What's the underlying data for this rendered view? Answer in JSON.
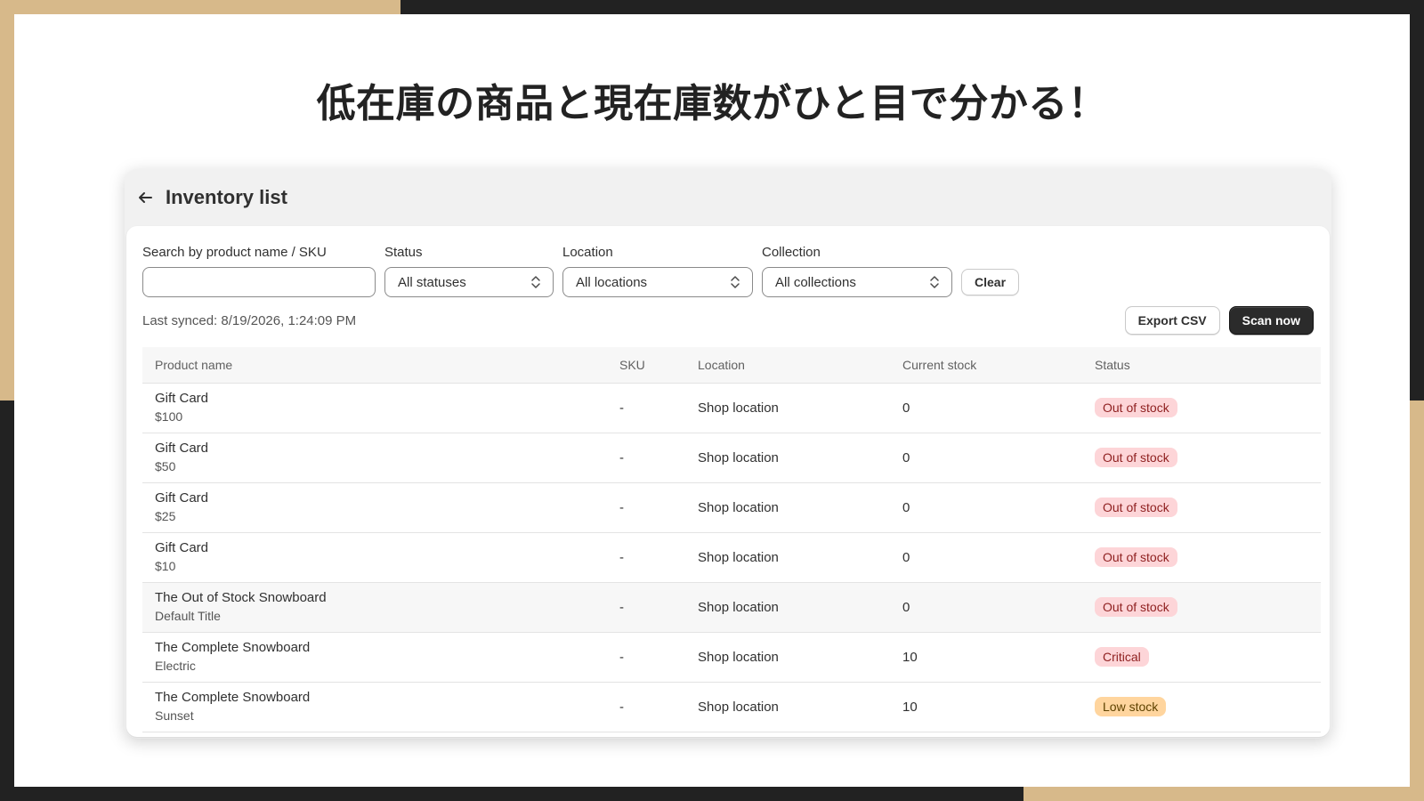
{
  "headline": "低在庫の商品と現在庫数がひと目で分かる！",
  "app": {
    "title": "Inventory list",
    "back_icon": "arrow-left-icon"
  },
  "filters": {
    "search_label": "Search by product name / SKU",
    "search_value": "",
    "status_label": "Status",
    "status_value": "All statuses",
    "location_label": "Location",
    "location_value": "All locations",
    "collection_label": "Collection",
    "collection_value": "All collections",
    "clear_label": "Clear"
  },
  "sync": {
    "text": "Last synced: 8/19/2026, 1:24:09 PM",
    "export_label": "Export CSV",
    "scan_label": "Scan now"
  },
  "table": {
    "columns": [
      "Product name",
      "SKU",
      "Location",
      "Current stock",
      "Status"
    ],
    "rows": [
      {
        "name": "Gift Card",
        "variant": "$100",
        "sku": "-",
        "location": "Shop location",
        "stock": "0",
        "status": "Out of stock"
      },
      {
        "name": "Gift Card",
        "variant": "$50",
        "sku": "-",
        "location": "Shop location",
        "stock": "0",
        "status": "Out of stock"
      },
      {
        "name": "Gift Card",
        "variant": "$25",
        "sku": "-",
        "location": "Shop location",
        "stock": "0",
        "status": "Out of stock"
      },
      {
        "name": "Gift Card",
        "variant": "$10",
        "sku": "-",
        "location": "Shop location",
        "stock": "0",
        "status": "Out of stock"
      },
      {
        "name": "The Out of Stock Snowboard",
        "variant": "Default Title",
        "sku": "-",
        "location": "Shop location",
        "stock": "0",
        "status": "Out of stock"
      },
      {
        "name": "The Complete Snowboard",
        "variant": "Electric",
        "sku": "-",
        "location": "Shop location",
        "stock": "10",
        "status": "Critical"
      },
      {
        "name": "The Complete Snowboard",
        "variant": "Sunset",
        "sku": "-",
        "location": "Shop location",
        "stock": "10",
        "status": "Low stock"
      }
    ]
  },
  "colors": {
    "accent_tan": "#d7b98a",
    "frame_dark": "#222222",
    "badge_out_bg": "#fdd5d8",
    "badge_low_bg": "#ffd59e",
    "primary_button": "#2b2b2b"
  }
}
